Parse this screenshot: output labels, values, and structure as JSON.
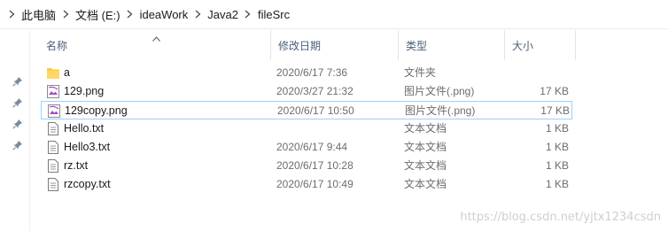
{
  "breadcrumb": [
    "此电脑",
    "文档 (E:)",
    "ideaWork",
    "Java2",
    "fileSrc"
  ],
  "columns": {
    "name": "名称",
    "date": "修改日期",
    "type": "类型",
    "size": "大小"
  },
  "files": [
    {
      "name": "a",
      "date": "2020/6/17 7:36",
      "type": "文件夹",
      "size": "",
      "icon": "folder-icon"
    },
    {
      "name": "129.png",
      "date": "2020/3/27 21:32",
      "type": "图片文件(.png)",
      "size": "17 KB",
      "icon": "image-file-icon"
    },
    {
      "name": "129copy.png",
      "date": "2020/6/17 10:50",
      "type": "图片文件(.png)",
      "size": "17 KB",
      "icon": "image-file-icon",
      "selected": true
    },
    {
      "name": "Hello.txt",
      "date": "",
      "type": "文本文档",
      "size": "1 KB",
      "icon": "text-file-icon"
    },
    {
      "name": "Hello3.txt",
      "date": "2020/6/17 9:44",
      "type": "文本文档",
      "size": "1 KB",
      "icon": "text-file-icon"
    },
    {
      "name": "rz.txt",
      "date": "2020/6/17 10:28",
      "type": "文本文档",
      "size": "1 KB",
      "icon": "text-file-icon"
    },
    {
      "name": "rzcopy.txt",
      "date": "2020/6/17 10:49",
      "type": "文本文档",
      "size": "1 KB",
      "icon": "text-file-icon"
    }
  ],
  "watermark": "https://blog.csdn.net/yjtx1234csdn",
  "colors": {
    "header_text": "#4c607a",
    "selection_border": "#99d1ff",
    "folder": "#ffc83d",
    "image_icon": "#a44ec6"
  }
}
